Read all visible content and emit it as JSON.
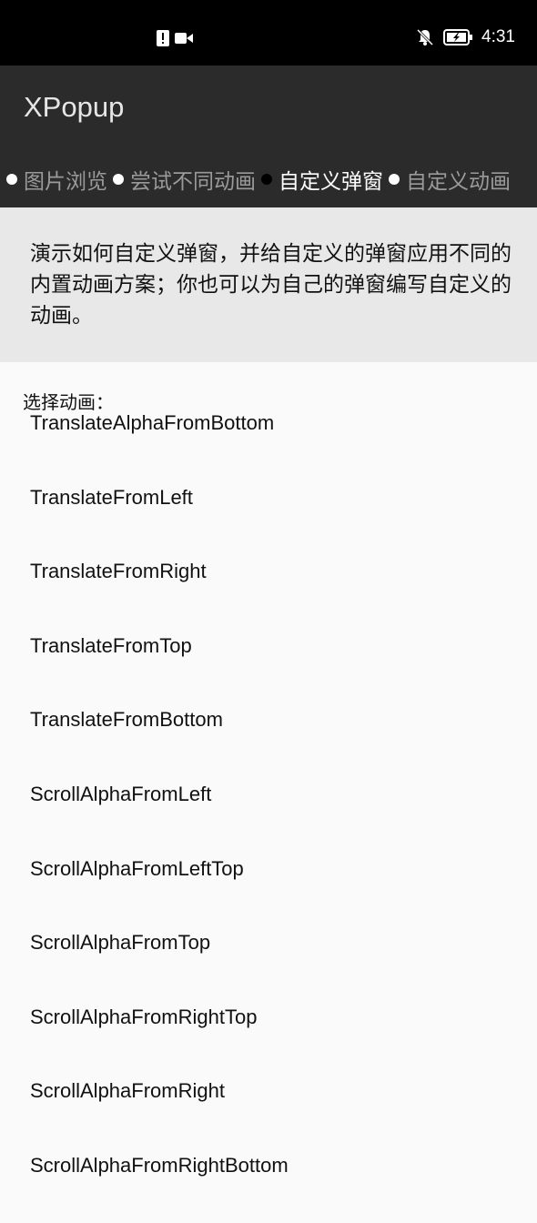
{
  "status_bar": {
    "time": "4:31",
    "icons": [
      "alert-icon",
      "video-icon",
      "bell-off-icon",
      "battery-charging-icon"
    ]
  },
  "app_bar": {
    "title": "XPopup"
  },
  "tabs": [
    {
      "label": "图片浏览",
      "active": false
    },
    {
      "label": "尝试不同动画",
      "active": false
    },
    {
      "label": "自定义弹窗",
      "active": true
    },
    {
      "label": "自定义动画",
      "active": false
    }
  ],
  "description": "演示如何自定义弹窗，并给自定义的弹窗应用不同的内置动画方案；你也可以为自己的弹窗编写自定义的动画。",
  "choose_label": "选择动画：",
  "animations": [
    "TranslateAlphaFromBottom",
    "TranslateFromLeft",
    "TranslateFromRight",
    "TranslateFromTop",
    "TranslateFromBottom",
    "ScrollAlphaFromLeft",
    "ScrollAlphaFromLeftTop",
    "ScrollAlphaFromTop",
    "ScrollAlphaFromRightTop",
    "ScrollAlphaFromRight",
    "ScrollAlphaFromRightBottom"
  ],
  "colors": {
    "status_bar": "#000000",
    "app_bar": "#2b2b2b",
    "description_panel": "#e8e8e8",
    "content_bg": "#fafafa",
    "tab_active": "#ffffff",
    "tab_inactive": "#9a9a9a"
  }
}
